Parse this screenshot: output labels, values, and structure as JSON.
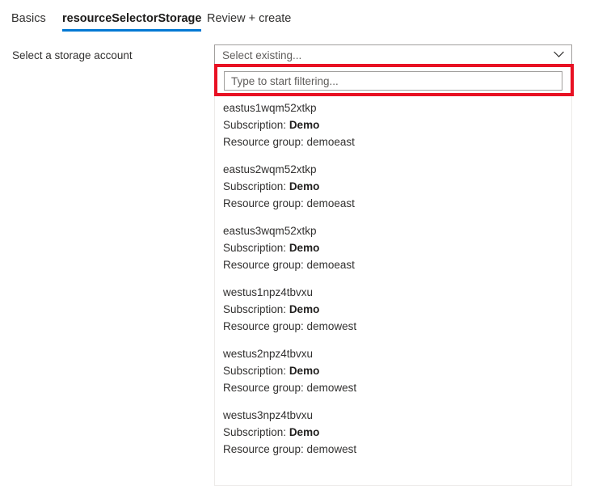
{
  "tabs": [
    {
      "label": "Basics",
      "selected": false
    },
    {
      "label": "resourceSelectorStorage",
      "selected": true
    },
    {
      "label": "Review + create",
      "selected": false
    }
  ],
  "form": {
    "field_label": "Select a storage account",
    "select_value": "Select existing...",
    "chevron_icon": "chevron-down-icon"
  },
  "dropdown": {
    "filter_placeholder": "Type to start filtering...",
    "filter_value": "",
    "subscription_label": "Subscription:",
    "resource_group_label": "Resource group:",
    "options": [
      {
        "name": "eastus1wqm52xtkp",
        "subscription_label": "Subscription:",
        "subscription": "Demo",
        "resource_group_line": "Resource group: demoeast"
      },
      {
        "name": "eastus2wqm52xtkp",
        "subscription_label": "Subscription:",
        "subscription": "Demo",
        "resource_group_line": "Resource group: demoeast"
      },
      {
        "name": "eastus3wqm52xtkp",
        "subscription_label": "Subscription:",
        "subscription": "Demo",
        "resource_group_line": "Resource group: demoeast"
      },
      {
        "name": "westus1npz4tbvxu",
        "subscription_label": "Subscription:",
        "subscription": "Demo",
        "resource_group_line": "Resource group: demowest"
      },
      {
        "name": "westus2npz4tbvxu",
        "subscription_label": "Subscription:",
        "subscription": "Demo",
        "resource_group_line": "Resource group: demowest"
      },
      {
        "name": "westus3npz4tbvxu",
        "subscription_label": "Subscription:",
        "subscription": "Demo",
        "resource_group_line": "Resource group: demowest"
      }
    ]
  },
  "annotation": {
    "color": "#e81123"
  },
  "colors": {
    "accent": "#0078d4",
    "text": "#323130",
    "placeholder": "#605e5c",
    "border": "#a19f9d",
    "panel_border": "#edebe9",
    "annotation": "#e81123"
  }
}
